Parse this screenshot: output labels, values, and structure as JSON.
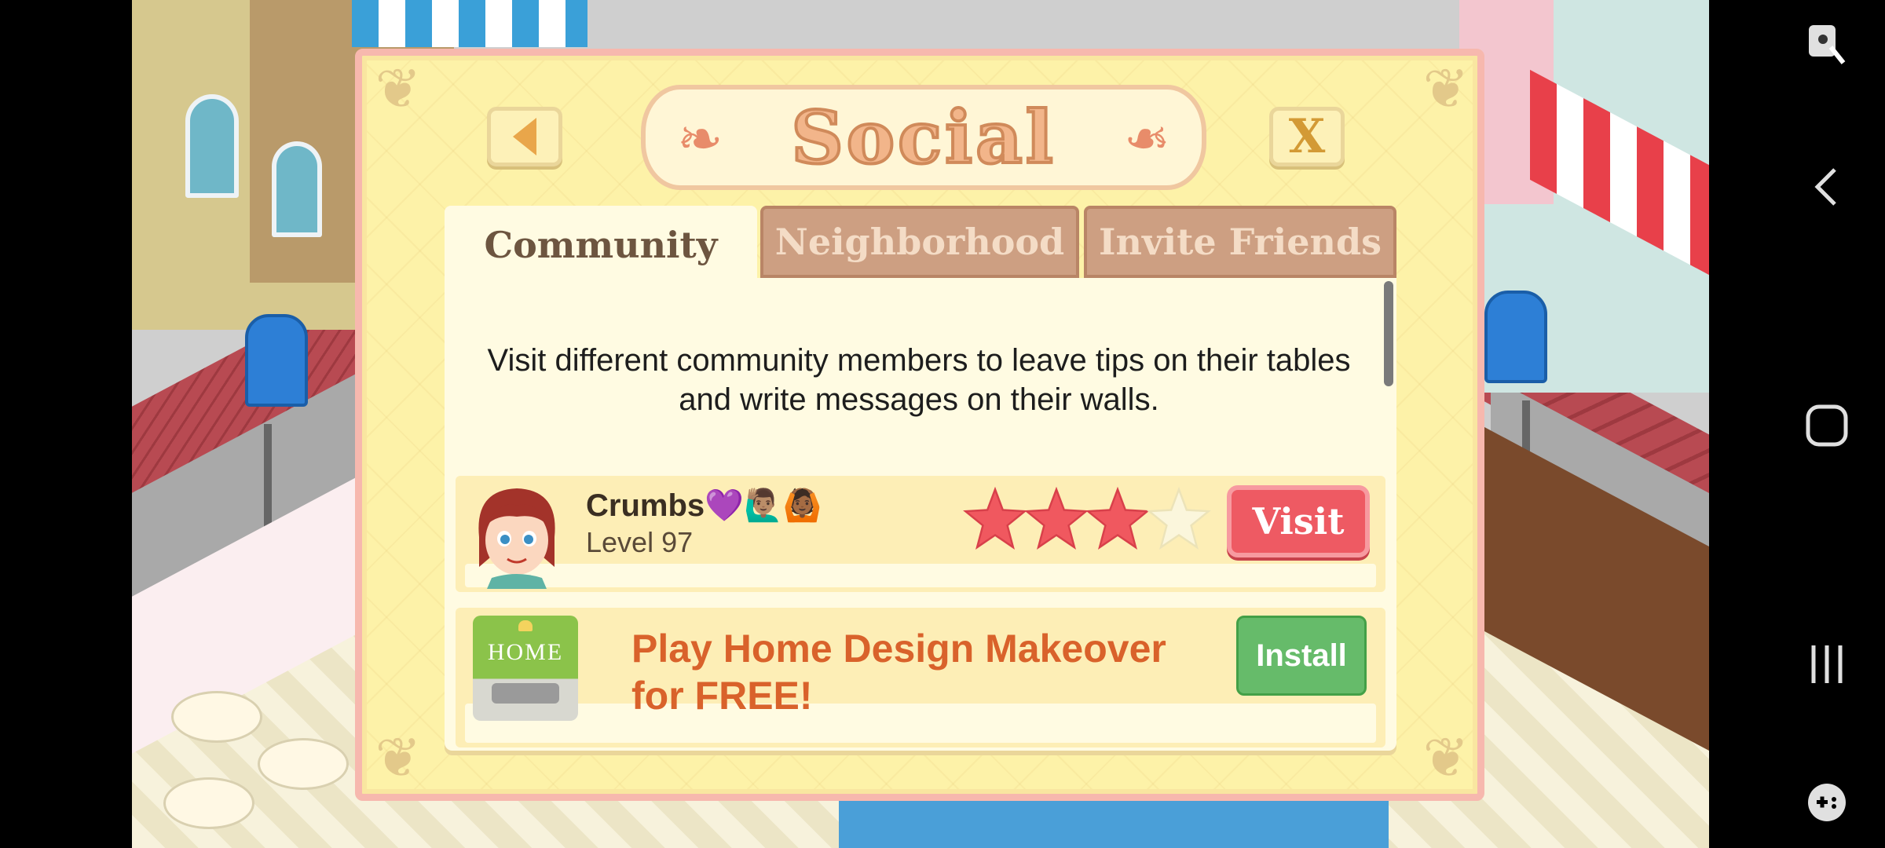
{
  "dialog": {
    "title": "Social",
    "back_icon": "triangle-left-icon",
    "close_label": "X"
  },
  "tabs": [
    {
      "label": "Community",
      "active": true
    },
    {
      "label": "Neighborhood",
      "active": false
    },
    {
      "label": "Invite Friends",
      "active": false
    }
  ],
  "intro_text": "Visit different community members to leave tips on their tables and write messages on their walls.",
  "members": [
    {
      "name": "Crumbs💜🙋🏽‍♂️🙆🏾",
      "level": "Level 97",
      "stars": 3,
      "max_stars": 4,
      "action": "Visit"
    }
  ],
  "ad": {
    "icon_text": "HOME",
    "text": "Play Home Design Makeover for FREE!",
    "action": "Install"
  },
  "system_nav": [
    "accessibility-icon",
    "back-icon",
    "home-icon",
    "recents-icon",
    "game-tools-icon"
  ],
  "colors": {
    "dialog_bg": "#fdf2a8",
    "dialog_border": "#f7b8ae",
    "visit_button": "#ee5a63",
    "install_button": "#66bb6a",
    "ad_text": "#d9622b",
    "star_filled": "#f0585f"
  }
}
